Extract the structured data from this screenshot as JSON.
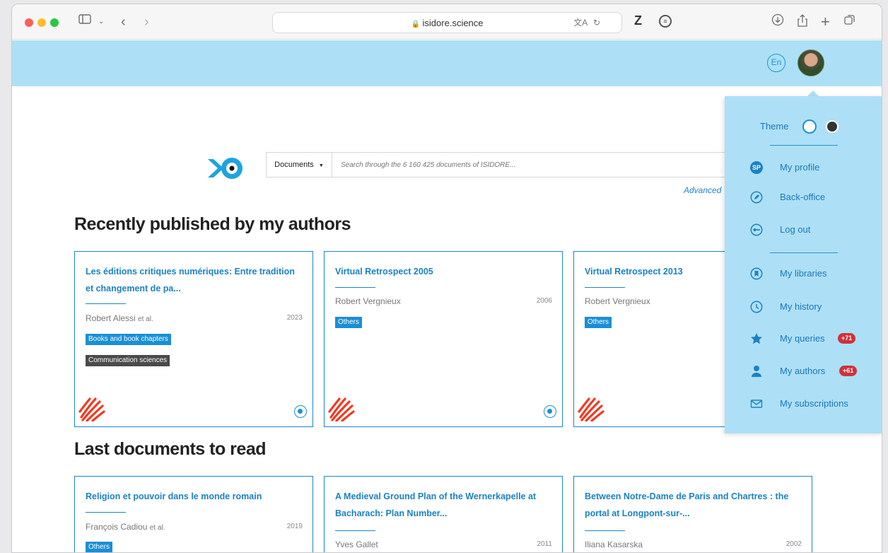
{
  "browser": {
    "url": "isidore.science",
    "icons": [
      "sidebar-icon",
      "chevron-down-icon",
      "back-icon",
      "forward-icon",
      "lock-icon",
      "translate-icon",
      "reload-icon",
      "zotero-icon",
      "shield-icon",
      "download-icon",
      "share-icon",
      "new-tab-icon",
      "tabs-icon"
    ]
  },
  "header": {
    "lang": "En"
  },
  "search": {
    "type_label": "Documents",
    "placeholder": "Search through the 6 160 425 documents of ISIDORE...",
    "advanced_label": "Advanced"
  },
  "sections": {
    "recent_title": "Recently published by my authors",
    "last_title": "Last documents to read"
  },
  "recent_cards": [
    {
      "title": "Les éditions critiques numériques: Entre tradition et changement de pa...",
      "author": "Robert Alessi",
      "etal": "et al.",
      "year": "2023",
      "tags": [
        "Books and book chapters",
        "Communication sciences"
      ]
    },
    {
      "title": "Virtual Retrospect 2005",
      "author": "Robert Vergnieux",
      "etal": "",
      "year": "2006",
      "tags": [
        "Others"
      ]
    },
    {
      "title": "Virtual Retrospect 2013",
      "author": "Robert Vergnieux",
      "etal": "",
      "year": "",
      "tags": [
        "Others"
      ]
    }
  ],
  "last_cards": [
    {
      "title": "Religion et pouvoir dans le monde romain",
      "author": "François Cadiou",
      "etal": "et al.",
      "year": "2019",
      "tags": [
        "Others"
      ]
    },
    {
      "title": "A Medieval Ground Plan of the Wernerkapelle at Bacharach: Plan Number...",
      "author": "Yves Gallet",
      "etal": "",
      "year": "2011",
      "tags": []
    },
    {
      "title": "Between Notre-Dame de Paris and Chartres : the portal at Longpont-sur-...",
      "author": "Iliana Kasarska",
      "etal": "",
      "year": "2002",
      "tags": []
    }
  ],
  "menu": {
    "theme_label": "Theme",
    "profile_initials": "SP",
    "items": [
      {
        "label": "My profile",
        "icon": "profile-initials-icon",
        "badge": ""
      },
      {
        "label": "Back-office",
        "icon": "pencil-icon",
        "badge": ""
      },
      {
        "label": "Log out",
        "icon": "key-icon",
        "badge": ""
      },
      {
        "label": "My libraries",
        "icon": "bookmark-icon",
        "badge": ""
      },
      {
        "label": "My history",
        "icon": "clock-icon",
        "badge": ""
      },
      {
        "label": "My queries",
        "icon": "star-icon",
        "badge": "+71"
      },
      {
        "label": "My authors",
        "icon": "user-icon",
        "badge": "+61"
      },
      {
        "label": "My subscriptions",
        "icon": "envelope-icon",
        "badge": ""
      }
    ]
  },
  "colors": {
    "accent": "#1a82c4",
    "header_bg": "#ade0f6",
    "badge": "#d0313b",
    "source_logo": "#f03a22"
  }
}
